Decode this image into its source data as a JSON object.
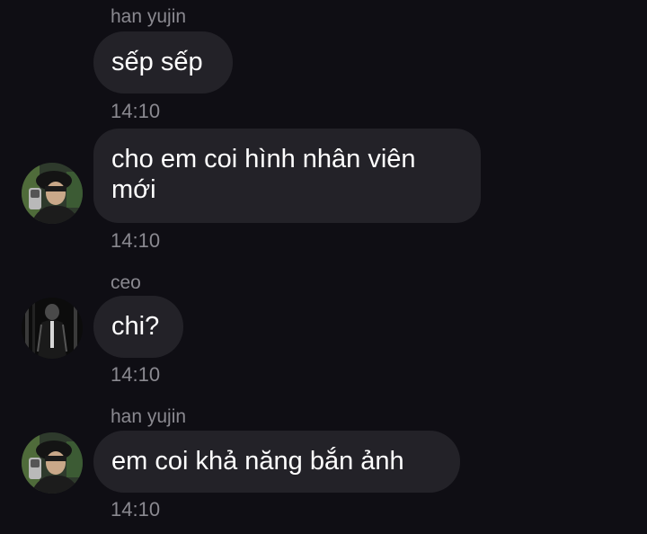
{
  "messages": [
    {
      "sender": "han yujin",
      "text": "sếp sếp",
      "time": "14:10"
    },
    {
      "sender": "",
      "text": "cho em coi hình nhân viên mới",
      "time": "14:10"
    },
    {
      "sender": "ceo",
      "text": "chi?",
      "time": "14:10"
    },
    {
      "sender": "han yujin",
      "text": "em coi khả năng bắn ảnh",
      "time": "14:10"
    }
  ],
  "avatars": {
    "han_yujin": "profile-photo",
    "ceo": "profile-photo"
  },
  "colors": {
    "background": "#0f0e14",
    "bubble": "#232228",
    "meta_text": "#8a8990",
    "message_text": "#ffffff"
  }
}
